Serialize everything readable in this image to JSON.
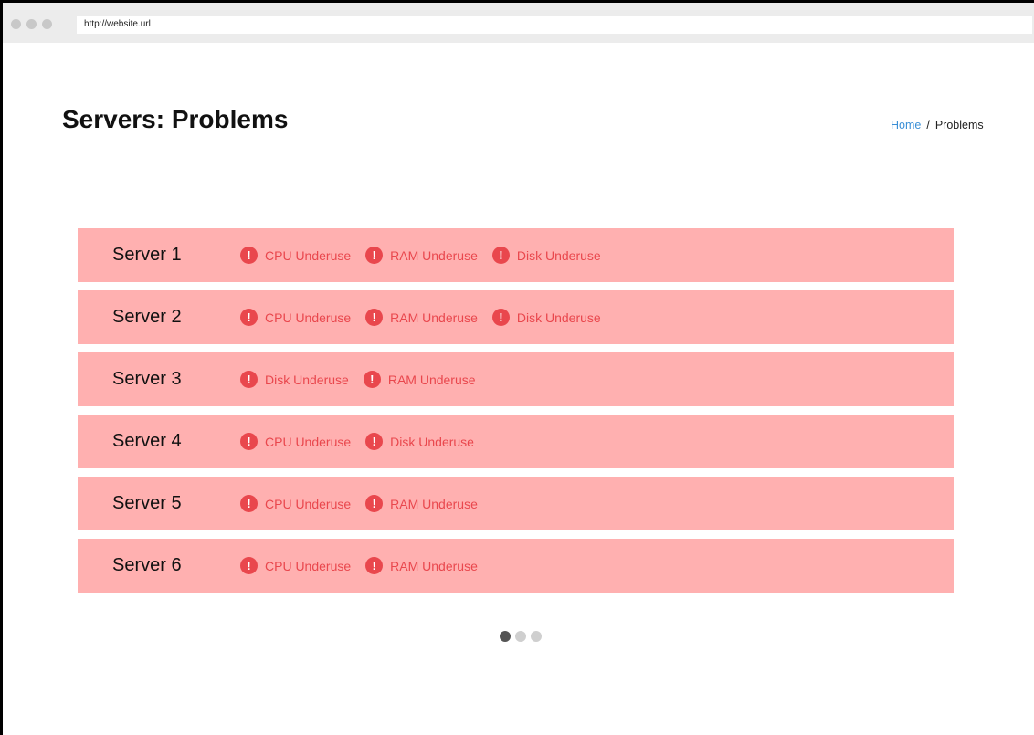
{
  "browser": {
    "url": "http://website.url",
    "window_dots": [
      "window-dot",
      "window-dot",
      "window-dot"
    ]
  },
  "header": {
    "title": "Servers: Problems",
    "breadcrumb": {
      "home": "Home",
      "separator": "/",
      "current": "Problems"
    }
  },
  "servers": [
    {
      "name": "Server 1",
      "issues": [
        "CPU Underuse",
        "RAM Underuse",
        "Disk Underuse"
      ]
    },
    {
      "name": "Server 2",
      "issues": [
        "CPU Underuse",
        "RAM Underuse",
        "Disk Underuse"
      ]
    },
    {
      "name": "Server 3",
      "issues": [
        "Disk Underuse",
        "RAM Underuse"
      ]
    },
    {
      "name": "Server 4",
      "issues": [
        "CPU Underuse",
        "Disk Underuse"
      ]
    },
    {
      "name": "Server 5",
      "issues": [
        "CPU Underuse",
        "RAM Underuse"
      ]
    },
    {
      "name": "Server 6",
      "issues": [
        "CPU Underuse",
        "RAM Underuse"
      ]
    }
  ],
  "issue_icon": {
    "name": "alert-icon",
    "glyph": "!"
  },
  "pagination": {
    "pages": 3,
    "current": 1
  },
  "colors": {
    "row_background": "#ffb0b0",
    "issue_red": "#e9474d",
    "link_blue": "#3a8fd6",
    "pager_active": "#555555",
    "pager_inactive": "#cfcfcf"
  }
}
